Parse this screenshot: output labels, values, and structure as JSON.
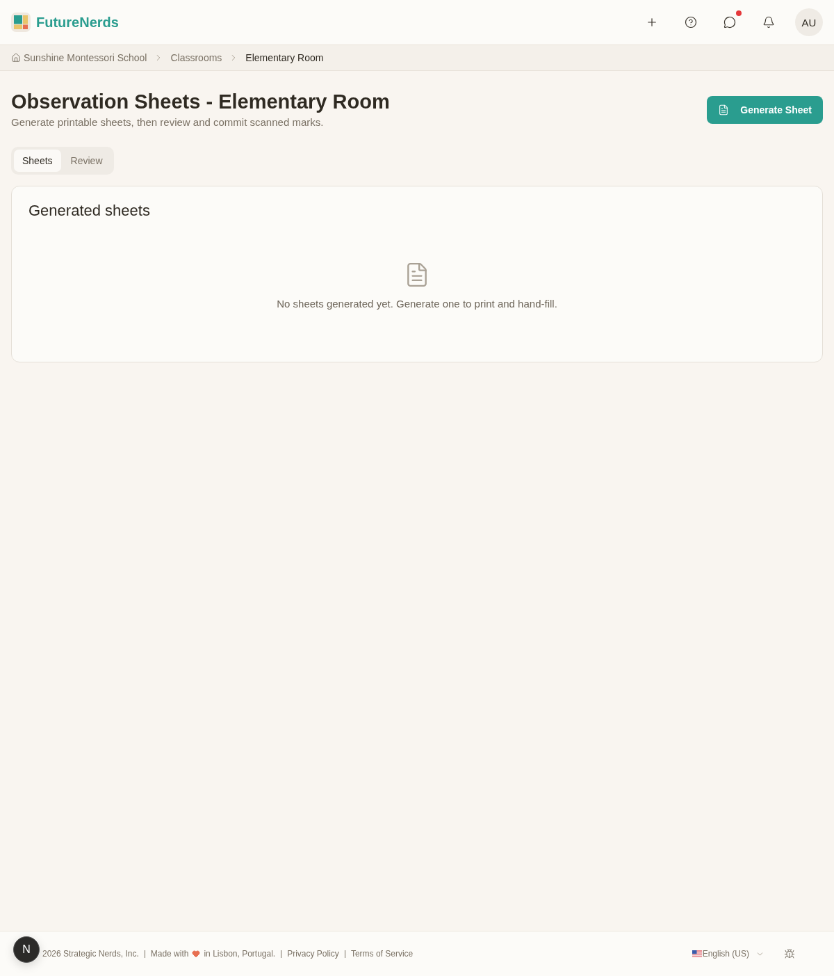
{
  "header": {
    "brand": "FutureNerds",
    "messages": {
      "unread": true
    },
    "avatar": {
      "initials": "AU"
    }
  },
  "breadcrumb": [
    {
      "label": "Sunshine Montessori School",
      "current": false
    },
    {
      "label": "Classrooms",
      "current": false
    },
    {
      "label": "Elementary Room",
      "current": true
    }
  ],
  "page": {
    "title": "Observation Sheets - Elementary Room",
    "subtitle": "Generate printable sheets, then review and commit scanned marks.",
    "primary_action": "Generate Sheet"
  },
  "tabs": [
    {
      "label": "Sheets",
      "selected": true
    },
    {
      "label": "Review",
      "selected": false
    }
  ],
  "card": {
    "title": "Generated sheets",
    "empty_message": "No sheets generated yet. Generate one to print and hand-fill."
  },
  "footer": {
    "copyright": "2026 Strategic Nerds, Inc.",
    "made_with": {
      "before": "Made with",
      "after": "in Lisbon, Portugal."
    },
    "links": [
      "Privacy Policy",
      "Terms of Service"
    ],
    "language": "English (US)"
  },
  "dev_badge": {
    "letter": "N"
  }
}
